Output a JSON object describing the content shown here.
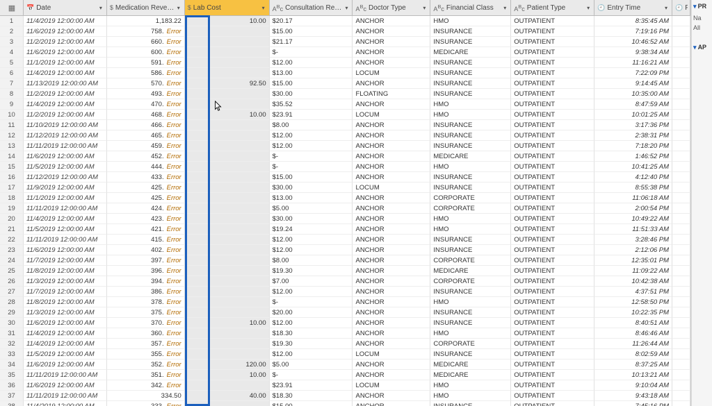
{
  "side": {
    "pr": "PR",
    "na": "Na",
    "all": "All",
    "ap_hdr": "AP"
  },
  "headers": {
    "date": "Date",
    "med": "Medication Revenue",
    "lab": "Lab Cost",
    "cons": "Consultation Revenue",
    "doc": "Doctor Type",
    "fin": "Financial Class",
    "pat": "Patient Type",
    "time": "Entry Time",
    "post": "Pos"
  },
  "error_label": "Error",
  "rows": [
    {
      "i": 1,
      "date": "11/4/2019 12:00:00 AM",
      "med": "1,183.22",
      "lab": "10.00",
      "cons": "$20.17",
      "doc": "ANCHOR",
      "fin": "HMO",
      "pat": "OUTPATIENT",
      "time": "8:35:45 AM"
    },
    {
      "i": 2,
      "date": "11/6/2019 12:00:00 AM",
      "med": "758.",
      "err": true,
      "lab": "",
      "cons": "$15.00",
      "doc": "ANCHOR",
      "fin": "INSURANCE",
      "pat": "OUTPATIENT",
      "time": "7:19:16 PM"
    },
    {
      "i": 3,
      "date": "11/2/2019 12:00:00 AM",
      "med": "660.",
      "err": true,
      "lab": "",
      "cons": "$21.17",
      "doc": "ANCHOR",
      "fin": "INSURANCE",
      "pat": "OUTPATIENT",
      "time": "10:46:52 AM"
    },
    {
      "i": 4,
      "date": "11/6/2019 12:00:00 AM",
      "med": "600.",
      "err": true,
      "lab": "",
      "cons": "$-",
      "doc": "ANCHOR",
      "fin": "MEDICARE",
      "pat": "OUTPATIENT",
      "time": "9:38:34 AM"
    },
    {
      "i": 5,
      "date": "11/1/2019 12:00:00 AM",
      "med": "591.",
      "err": true,
      "lab": "",
      "cons": "$12.00",
      "doc": "ANCHOR",
      "fin": "INSURANCE",
      "pat": "OUTPATIENT",
      "time": "11:16:21 AM"
    },
    {
      "i": 6,
      "date": "11/4/2019 12:00:00 AM",
      "med": "586.",
      "err": true,
      "lab": "",
      "cons": "$13.00",
      "doc": "LOCUM",
      "fin": "INSURANCE",
      "pat": "OUTPATIENT",
      "time": "7:22:09 PM"
    },
    {
      "i": 7,
      "date": "11/13/2019 12:00:00 AM",
      "med": "570.",
      "err": true,
      "lab": "92.50",
      "cons": "$15.00",
      "doc": "ANCHOR",
      "fin": "INSURANCE",
      "pat": "OUTPATIENT",
      "time": "9:14:45 AM"
    },
    {
      "i": 8,
      "date": "11/2/2019 12:00:00 AM",
      "med": "493.",
      "err": true,
      "lab": "",
      "cons": "$30.00",
      "doc": "FLOATING",
      "fin": "INSURANCE",
      "pat": "OUTPATIENT",
      "time": "10:35:00 AM"
    },
    {
      "i": 9,
      "date": "11/4/2019 12:00:00 AM",
      "med": "470.",
      "err": true,
      "lab": "",
      "cons": "$35.52",
      "doc": "ANCHOR",
      "fin": "HMO",
      "pat": "OUTPATIENT",
      "time": "8:47:59 AM"
    },
    {
      "i": 10,
      "date": "11/2/2019 12:00:00 AM",
      "med": "468.",
      "err": true,
      "lab": "10.00",
      "cons": "$23.91",
      "doc": "LOCUM",
      "fin": "HMO",
      "pat": "OUTPATIENT",
      "time": "10:01:25 AM"
    },
    {
      "i": 11,
      "date": "11/10/2019 12:00:00 AM",
      "med": "466.",
      "err": true,
      "lab": "",
      "cons": "$8.00",
      "doc": "ANCHOR",
      "fin": "INSURANCE",
      "pat": "OUTPATIENT",
      "time": "3:17:36 PM"
    },
    {
      "i": 12,
      "date": "11/12/2019 12:00:00 AM",
      "med": "465.",
      "err": true,
      "lab": "",
      "cons": "$12.00",
      "doc": "ANCHOR",
      "fin": "INSURANCE",
      "pat": "OUTPATIENT",
      "time": "2:38:31 PM"
    },
    {
      "i": 13,
      "date": "11/11/2019 12:00:00 AM",
      "med": "459.",
      "err": true,
      "lab": "",
      "cons": "$12.00",
      "doc": "ANCHOR",
      "fin": "INSURANCE",
      "pat": "OUTPATIENT",
      "time": "7:18:20 PM"
    },
    {
      "i": 14,
      "date": "11/6/2019 12:00:00 AM",
      "med": "452.",
      "err": true,
      "lab": "",
      "cons": "$-",
      "doc": "ANCHOR",
      "fin": "MEDICARE",
      "pat": "OUTPATIENT",
      "time": "1:46:52 PM"
    },
    {
      "i": 15,
      "date": "11/5/2019 12:00:00 AM",
      "med": "444.",
      "err": true,
      "lab": "",
      "cons": "$-",
      "doc": "ANCHOR",
      "fin": "HMO",
      "pat": "OUTPATIENT",
      "time": "10:41:25 AM"
    },
    {
      "i": 16,
      "date": "11/12/2019 12:00:00 AM",
      "med": "433.",
      "err": true,
      "lab": "",
      "cons": "$15.00",
      "doc": "ANCHOR",
      "fin": "INSURANCE",
      "pat": "OUTPATIENT",
      "time": "4:12:40 PM"
    },
    {
      "i": 17,
      "date": "11/9/2019 12:00:00 AM",
      "med": "425.",
      "err": true,
      "lab": "",
      "cons": "$30.00",
      "doc": "LOCUM",
      "fin": "INSURANCE",
      "pat": "OUTPATIENT",
      "time": "8:55:38 PM"
    },
    {
      "i": 18,
      "date": "11/1/2019 12:00:00 AM",
      "med": "425.",
      "err": true,
      "lab": "",
      "cons": "$13.00",
      "doc": "ANCHOR",
      "fin": "CORPORATE",
      "pat": "OUTPATIENT",
      "time": "11:06:18 AM"
    },
    {
      "i": 19,
      "date": "11/11/2019 12:00:00 AM",
      "med": "424.",
      "err": true,
      "lab": "",
      "cons": "$5.00",
      "doc": "ANCHOR",
      "fin": "CORPORATE",
      "pat": "OUTPATIENT",
      "time": "2:00:54 PM"
    },
    {
      "i": 20,
      "date": "11/4/2019 12:00:00 AM",
      "med": "423.",
      "err": true,
      "lab": "",
      "cons": "$30.00",
      "doc": "ANCHOR",
      "fin": "HMO",
      "pat": "OUTPATIENT",
      "time": "10:49:22 AM"
    },
    {
      "i": 21,
      "date": "11/5/2019 12:00:00 AM",
      "med": "421.",
      "err": true,
      "lab": "",
      "cons": "$19.24",
      "doc": "ANCHOR",
      "fin": "HMO",
      "pat": "OUTPATIENT",
      "time": "11:51:33 AM"
    },
    {
      "i": 22,
      "date": "11/11/2019 12:00:00 AM",
      "med": "415.",
      "err": true,
      "lab": "",
      "cons": "$12.00",
      "doc": "ANCHOR",
      "fin": "INSURANCE",
      "pat": "OUTPATIENT",
      "time": "3:28:46 PM"
    },
    {
      "i": 23,
      "date": "11/6/2019 12:00:00 AM",
      "med": "402.",
      "err": true,
      "lab": "",
      "cons": "$12.00",
      "doc": "ANCHOR",
      "fin": "INSURANCE",
      "pat": "OUTPATIENT",
      "time": "2:12:06 PM"
    },
    {
      "i": 24,
      "date": "11/7/2019 12:00:00 AM",
      "med": "397.",
      "err": true,
      "lab": "",
      "cons": "$8.00",
      "doc": "ANCHOR",
      "fin": "CORPORATE",
      "pat": "OUTPATIENT",
      "time": "12:35:01 PM"
    },
    {
      "i": 25,
      "date": "11/8/2019 12:00:00 AM",
      "med": "396.",
      "err": true,
      "lab": "",
      "cons": "$19.30",
      "doc": "ANCHOR",
      "fin": "MEDICARE",
      "pat": "OUTPATIENT",
      "time": "11:09:22 AM"
    },
    {
      "i": 26,
      "date": "11/3/2019 12:00:00 AM",
      "med": "394.",
      "err": true,
      "lab": "",
      "cons": "$7.00",
      "doc": "ANCHOR",
      "fin": "CORPORATE",
      "pat": "OUTPATIENT",
      "time": "10:42:38 AM"
    },
    {
      "i": 27,
      "date": "11/7/2019 12:00:00 AM",
      "med": "386.",
      "err": true,
      "lab": "",
      "cons": "$12.00",
      "doc": "ANCHOR",
      "fin": "INSURANCE",
      "pat": "OUTPATIENT",
      "time": "4:37:51 PM"
    },
    {
      "i": 28,
      "date": "11/8/2019 12:00:00 AM",
      "med": "378.",
      "err": true,
      "lab": "",
      "cons": "$-",
      "doc": "ANCHOR",
      "fin": "HMO",
      "pat": "OUTPATIENT",
      "time": "12:58:50 PM"
    },
    {
      "i": 29,
      "date": "11/3/2019 12:00:00 AM",
      "med": "375.",
      "err": true,
      "lab": "",
      "cons": "$20.00",
      "doc": "ANCHOR",
      "fin": "INSURANCE",
      "pat": "OUTPATIENT",
      "time": "10:22:35 PM"
    },
    {
      "i": 30,
      "date": "11/6/2019 12:00:00 AM",
      "med": "370.",
      "err": true,
      "lab": "10.00",
      "cons": "$12.00",
      "doc": "ANCHOR",
      "fin": "INSURANCE",
      "pat": "OUTPATIENT",
      "time": "8:40:51 AM"
    },
    {
      "i": 31,
      "date": "11/4/2019 12:00:00 AM",
      "med": "360.",
      "err": true,
      "lab": "",
      "cons": "$18.30",
      "doc": "ANCHOR",
      "fin": "HMO",
      "pat": "OUTPATIENT",
      "time": "8:46:46 AM"
    },
    {
      "i": 32,
      "date": "11/4/2019 12:00:00 AM",
      "med": "357.",
      "err": true,
      "lab": "",
      "cons": "$19.30",
      "doc": "ANCHOR",
      "fin": "CORPORATE",
      "pat": "OUTPATIENT",
      "time": "11:26:44 AM"
    },
    {
      "i": 33,
      "date": "11/5/2019 12:00:00 AM",
      "med": "355.",
      "err": true,
      "lab": "",
      "cons": "$12.00",
      "doc": "LOCUM",
      "fin": "INSURANCE",
      "pat": "OUTPATIENT",
      "time": "8:02:59 AM"
    },
    {
      "i": 34,
      "date": "11/6/2019 12:00:00 AM",
      "med": "352.",
      "err": true,
      "lab": "120.00",
      "cons": "$5.00",
      "doc": "ANCHOR",
      "fin": "MEDICARE",
      "pat": "OUTPATIENT",
      "time": "8:37:25 AM"
    },
    {
      "i": 35,
      "date": "11/11/2019 12:00:00 AM",
      "med": "351.",
      "err": true,
      "lab": "10.00",
      "cons": "$-",
      "doc": "ANCHOR",
      "fin": "MEDICARE",
      "pat": "OUTPATIENT",
      "time": "10:13:21 AM"
    },
    {
      "i": 36,
      "date": "11/6/2019 12:00:00 AM",
      "med": "342.",
      "err": true,
      "lab": "",
      "cons": "$23.91",
      "doc": "LOCUM",
      "fin": "HMO",
      "pat": "OUTPATIENT",
      "time": "9:10:04 AM"
    },
    {
      "i": 37,
      "date": "11/11/2019 12:00:00 AM",
      "med": "334.50",
      "err": false,
      "lab": "40.00",
      "cons": "$18.30",
      "doc": "ANCHOR",
      "fin": "HMO",
      "pat": "OUTPATIENT",
      "time": "9:43:18 AM"
    },
    {
      "i": 38,
      "date": "11/4/2019 12:00:00 AM",
      "med": "333.",
      "err": true,
      "lab": "",
      "cons": "$15.00",
      "doc": "ANCHOR",
      "fin": "INSURANCE",
      "pat": "OUTPATIENT",
      "time": "7:45:16 PM"
    }
  ]
}
